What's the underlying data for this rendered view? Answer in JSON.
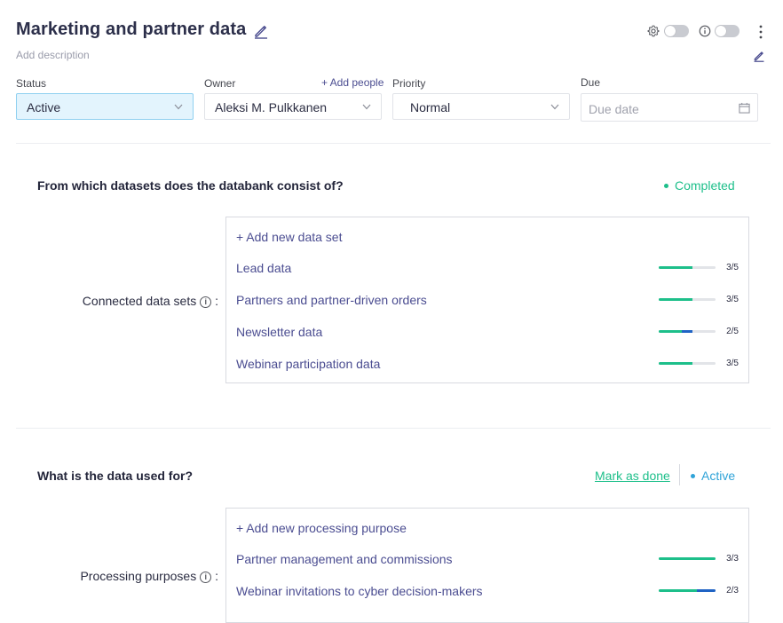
{
  "header": {
    "title": "Marketing and partner data",
    "description_placeholder": "Add description"
  },
  "fields": {
    "status": {
      "label": "Status",
      "value": "Active"
    },
    "owner": {
      "label": "Owner",
      "value": "Aleksi M. Pulkkanen",
      "add_people": "+ Add people"
    },
    "priority": {
      "label": "Priority",
      "value": "Normal"
    },
    "due": {
      "label": "Due",
      "placeholder": "Due date"
    }
  },
  "sections": [
    {
      "question": "From which datasets does the databank consist of?",
      "status": "Completed",
      "status_color": "#1dbf8a",
      "row_label": "Connected data sets",
      "add_label": "+ Add new data set",
      "items": [
        {
          "name": "Lead data",
          "count": "3/5",
          "progress": 0.6,
          "secondary": 0
        },
        {
          "name": "Partners and partner-driven orders",
          "count": "3/5",
          "progress": 0.6,
          "secondary": 0
        },
        {
          "name": "Newsletter data",
          "count": "2/5",
          "progress": 0.4,
          "secondary": 0.2
        },
        {
          "name": "Webinar participation data",
          "count": "3/5",
          "progress": 0.6,
          "secondary": 0
        }
      ]
    },
    {
      "question": "What is the data used for?",
      "mark_done": "Mark as done",
      "status": "Active",
      "status_color": "#2fa3d8",
      "row_label": "Processing purposes",
      "add_label": "+ Add new processing purpose",
      "items": [
        {
          "name": "Partner management and commissions",
          "count": "3/3",
          "progress": 1.0,
          "secondary": 0
        },
        {
          "name": "Webinar invitations to cyber decision-makers",
          "count": "2/3",
          "progress": 0.667,
          "secondary": 0.333
        }
      ]
    }
  ],
  "colors": {
    "accent_purple": "#4b4d91",
    "progress_green": "#1dbf8a",
    "progress_blue": "#1f63c4",
    "status_active_bg": "#e3f4fd"
  }
}
